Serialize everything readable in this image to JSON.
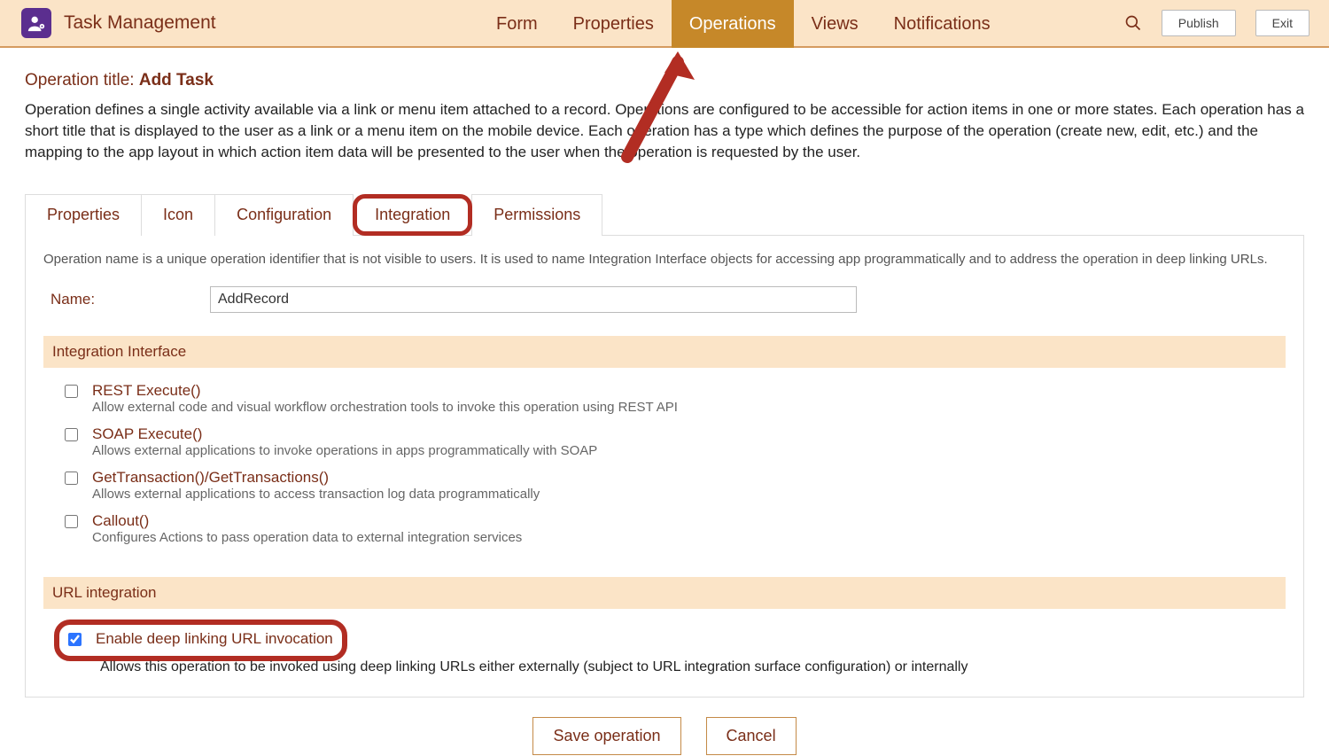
{
  "header": {
    "app_title": "Task Management",
    "tabs": [
      "Form",
      "Properties",
      "Operations",
      "Views",
      "Notifications"
    ],
    "active_tab_index": 2,
    "publish_label": "Publish",
    "exit_label": "Exit"
  },
  "op_title_prefix": "Operation title: ",
  "op_title_value": "Add Task",
  "op_desc": "Operation defines a single activity available via a link or menu item attached to a record. Operations are configured to be accessible for action items in one or more states. Each operation has a short title that is displayed to the user as a link or a menu item on the mobile device. Each operation has a type which defines the purpose of the operation (create new, edit, etc.) and the mapping to the app layout in which action item data will be presented to the user when the operation is requested by the user.",
  "subtabs": [
    "Properties",
    "Icon",
    "Configuration",
    "Integration",
    "Permissions"
  ],
  "panel_intro": "Operation name is a unique operation identifier that is not visible to users. It is used to name Integration Interface objects for accessing app programmatically and to address the operation in deep linking URLs.",
  "name_label": "Name:",
  "name_value": "AddRecord",
  "integration_section": "Integration Interface",
  "integration_items": [
    {
      "title": "REST Execute()",
      "sub": "Allow external code and visual workflow orchestration tools to invoke this operation using REST API",
      "checked": false
    },
    {
      "title": "SOAP Execute()",
      "sub": "Allows external applications to invoke operations in apps programmatically with SOAP",
      "checked": false
    },
    {
      "title": "GetTransaction()/GetTransactions()",
      "sub": "Allows external applications to access transaction log data programmatically",
      "checked": false
    },
    {
      "title": "Callout()",
      "sub": "Configures Actions to pass operation data to external integration services",
      "checked": false
    }
  ],
  "url_section": "URL integration",
  "deeplink": {
    "title": "Enable deep linking URL invocation",
    "sub": "Allows this operation to be invoked using deep linking URLs either externally (subject to URL integration surface configuration) or internally",
    "checked": true
  },
  "footer": {
    "save": "Save operation",
    "cancel": "Cancel"
  }
}
